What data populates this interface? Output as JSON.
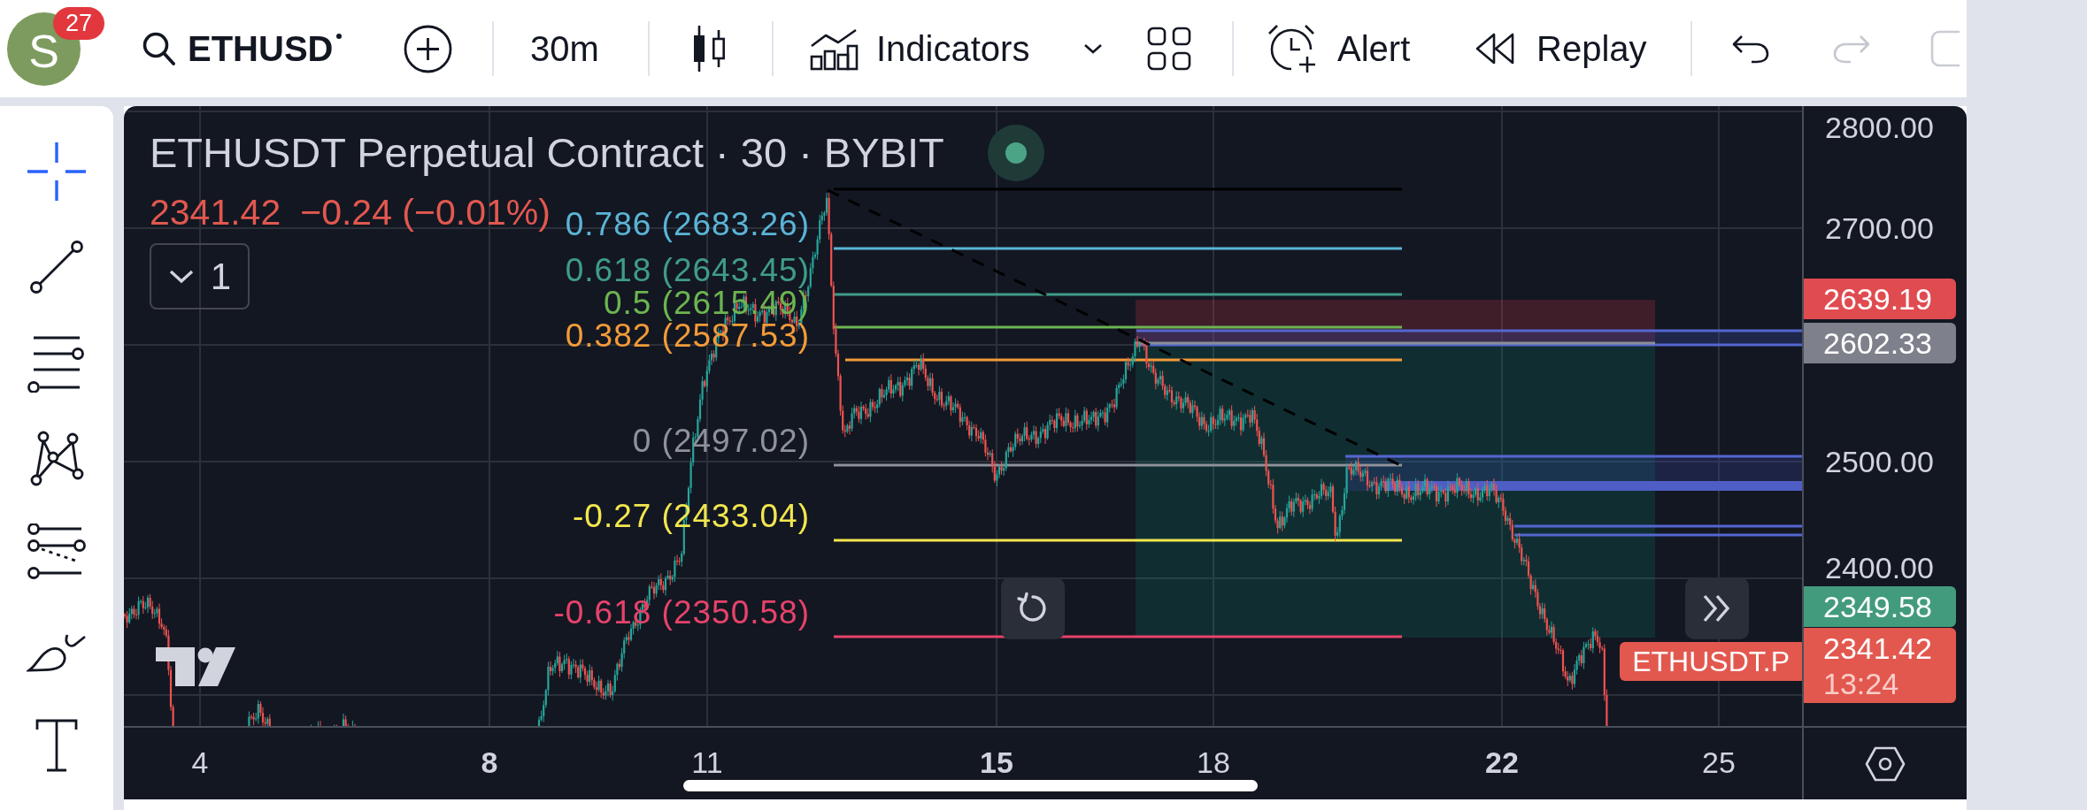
{
  "top_bar": {
    "avatar": {
      "letter": "S",
      "badge": "27"
    },
    "symbol": "ETHUSD",
    "interval": "30m",
    "indicators": "Indicators",
    "alert": "Alert",
    "replay": "Replay",
    "undo": {
      "disabled": false
    },
    "redo": {
      "disabled": true
    }
  },
  "tools": [
    {
      "kind": "crosshair",
      "selected": true
    },
    {
      "kind": "trend-line",
      "selected": false
    },
    {
      "kind": "fib-retracement",
      "selected": false
    },
    {
      "kind": "pattern",
      "selected": false
    },
    {
      "kind": "projection",
      "selected": false
    },
    {
      "kind": "brush",
      "selected": false
    },
    {
      "kind": "text",
      "selected": false
    }
  ],
  "chart": {
    "title": "ETHUSDT Perpetual Contract · 30 · BYBIT",
    "live": true,
    "quote": {
      "price": "2341.42",
      "change": "−0.24 (−0.01%)",
      "falling": true
    },
    "indicator_count": "1",
    "fib_levels": [
      {
        "label": "0.786 (2683.26)",
        "color": "#5ab5d6"
      },
      {
        "label": "0.618 (2643.45)",
        "color": "#3f9c88"
      },
      {
        "label": "0.5 (2615.49)",
        "color": "#6cb550"
      },
      {
        "label": "0.382 (2587.53)",
        "color": "#f29b38"
      },
      {
        "label": "0 (2497.02)",
        "color": "#8f929b"
      },
      {
        "label": "-0.27 (2433.04)",
        "color": "#f2e64e"
      },
      {
        "label": "-0.618 (2350.58)",
        "color": "#e6436a"
      }
    ],
    "symbol_tag": "ETHUSDT.P",
    "price_axis": {
      "ticks": [
        "2800.00",
        "2700.00",
        "2500.00",
        "2400.00"
      ],
      "badges": [
        {
          "value": "2639.19",
          "color": "#e04b50"
        },
        {
          "value": "2602.33",
          "color": "#7e818b"
        },
        {
          "value": "2349.58",
          "color": "#439b7d"
        },
        {
          "value": "2341.42",
          "sub": "13:24",
          "color": "#e2584f"
        }
      ]
    },
    "time_axis": [
      {
        "label": "4",
        "bold": false
      },
      {
        "label": "8",
        "bold": true
      },
      {
        "label": "11",
        "bold": false
      },
      {
        "label": "15",
        "bold": true
      },
      {
        "label": "18",
        "bold": false
      },
      {
        "label": "22",
        "bold": true
      },
      {
        "label": "25",
        "bold": false
      }
    ]
  }
}
